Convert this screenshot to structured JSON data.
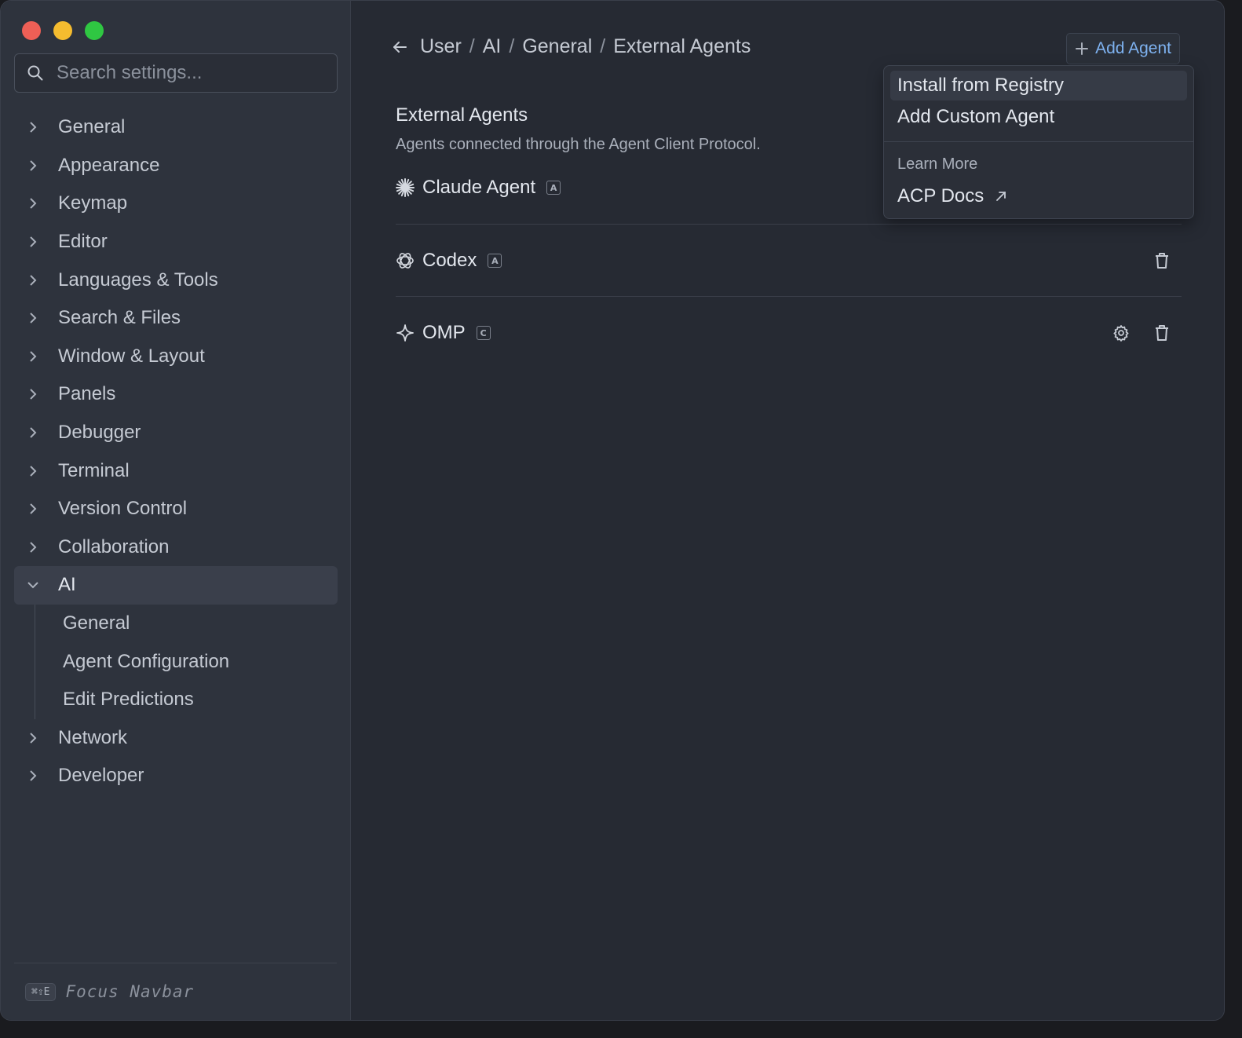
{
  "sidebar": {
    "search_placeholder": "Search settings...",
    "items": [
      {
        "label": "General"
      },
      {
        "label": "Appearance"
      },
      {
        "label": "Keymap"
      },
      {
        "label": "Editor"
      },
      {
        "label": "Languages & Tools"
      },
      {
        "label": "Search & Files"
      },
      {
        "label": "Window & Layout"
      },
      {
        "label": "Panels"
      },
      {
        "label": "Debugger"
      },
      {
        "label": "Terminal"
      },
      {
        "label": "Version Control"
      },
      {
        "label": "Collaboration"
      },
      {
        "label": "AI"
      },
      {
        "label": "Network"
      },
      {
        "label": "Developer"
      }
    ],
    "ai_subitems": [
      {
        "label": "General"
      },
      {
        "label": "Agent Configuration"
      },
      {
        "label": "Edit Predictions"
      }
    ],
    "footer": {
      "shortcut": "⌘⇧E",
      "label": "Focus Navbar"
    }
  },
  "breadcrumb": {
    "parts": [
      "User",
      "AI",
      "General",
      "External Agents"
    ],
    "separator": "/"
  },
  "toolbar": {
    "add_agent_label": "Add Agent"
  },
  "section": {
    "title": "External Agents",
    "description": "Agents connected through the Agent Client Protocol."
  },
  "agents": [
    {
      "name": "Claude Agent",
      "badge": "A",
      "icon": "asterisk-icon"
    },
    {
      "name": "Codex",
      "badge": "A",
      "icon": "openai-icon"
    },
    {
      "name": "OMP",
      "badge": "C",
      "icon": "sparkle-icon"
    }
  ],
  "dropdown": {
    "items": [
      "Install from Registry",
      "Add Custom Agent"
    ],
    "learn_more_label": "Learn More",
    "link_label": "ACP Docs"
  },
  "colors": {
    "accent": "#7eb2f0",
    "close": "#ee5f56",
    "minimize": "#f5bc2f",
    "zoom": "#2fc742"
  }
}
